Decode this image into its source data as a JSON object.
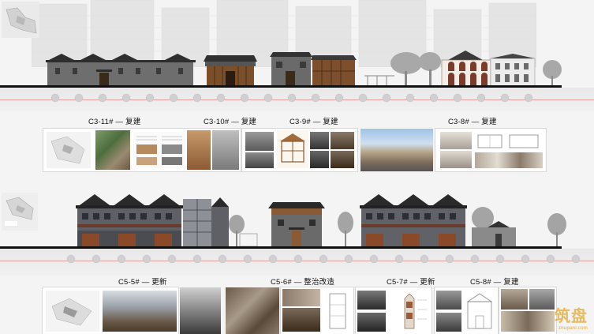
{
  "upper_row": {
    "captions": [
      {
        "name": "caption-c3-11",
        "text": "C3-11# — 复建"
      },
      {
        "name": "caption-c3-10",
        "text": "C3-10# — 复建"
      },
      {
        "name": "caption-c3-9",
        "text": "C3-9# — 复建"
      },
      {
        "name": "caption-c3-8",
        "text": "C3-8# — 复建"
      }
    ]
  },
  "lower_row": {
    "captions": [
      {
        "name": "caption-c5-5",
        "text": "C5-5# — 更新"
      },
      {
        "name": "caption-c5-6",
        "text": "C5-6# — 整治改造"
      },
      {
        "name": "caption-c5-7",
        "text": "C5-7# — 更新"
      },
      {
        "name": "caption-c5-8",
        "text": "C5-8# — 复建"
      }
    ]
  },
  "watermark": {
    "text": "筑盘",
    "sub": "zhupanr.com"
  },
  "colors": {
    "roof_dark": "#2e2e2e",
    "brick_gray": "#6b6b6b",
    "wood_brown": "#7a4f2a",
    "road_red": "#e08a8a",
    "tree_gray": "#9a9a9a"
  }
}
